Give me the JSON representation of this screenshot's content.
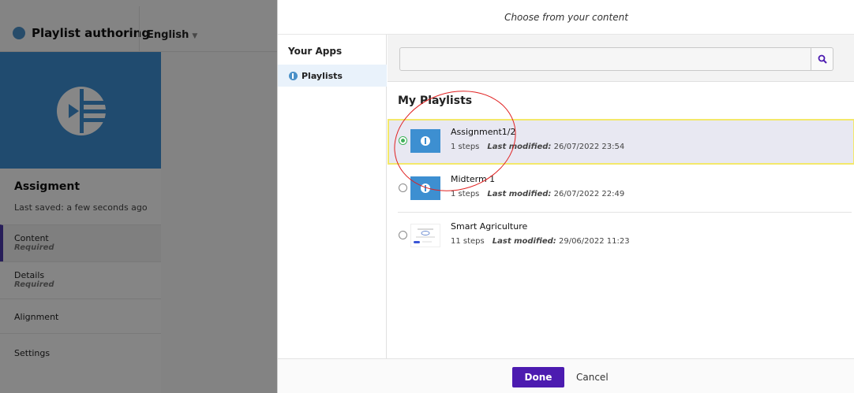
{
  "app": {
    "title": "Playlist authoring",
    "language": "English",
    "playlist_name": "Assigment",
    "last_saved": "Last saved: a few seconds ago",
    "nav": [
      {
        "label": "Content",
        "sub": "Required"
      },
      {
        "label": "Details",
        "sub": "Required"
      },
      {
        "label": "Alignment",
        "sub": ""
      },
      {
        "label": "Settings",
        "sub": ""
      }
    ]
  },
  "modal": {
    "title": "Choose from your content",
    "apps_heading": "Your Apps",
    "apps_item": "Playlists",
    "search": {
      "value": "",
      "placeholder": ""
    },
    "section_title": "My Playlists",
    "modified_label": "Last modified:",
    "items": [
      {
        "title": "Assignment1/2",
        "steps": "1 steps",
        "modified": "26/07/2022 23:54",
        "selected": true
      },
      {
        "title": "Midterm 1",
        "steps": "1 steps",
        "modified": "26/07/2022 22:49",
        "selected": false
      },
      {
        "title": "Smart Agriculture",
        "steps": "11 steps",
        "modified": "29/06/2022 11:23",
        "selected": false
      }
    ],
    "done_label": "Done",
    "cancel_label": "Cancel"
  },
  "colors": {
    "accent": "#4c1bb0",
    "brand_blue": "#3d8fd1",
    "selection_outline": "#f3e86a",
    "annotation": "#e02020",
    "radio_checked": "#40b15a"
  }
}
